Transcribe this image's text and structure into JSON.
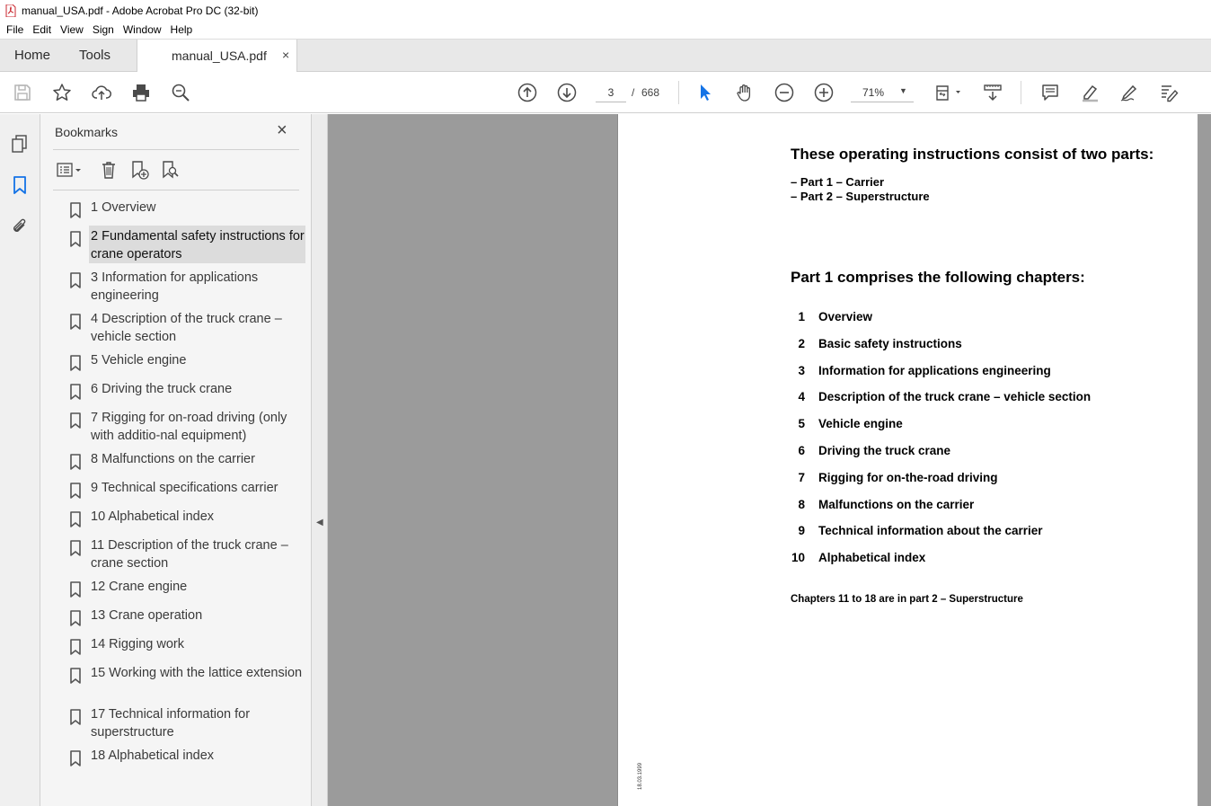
{
  "window": {
    "title": "manual_USA.pdf - Adobe Acrobat Pro DC (32-bit)"
  },
  "menu": [
    "File",
    "Edit",
    "View",
    "Sign",
    "Window",
    "Help"
  ],
  "tabs": {
    "home": "Home",
    "tools": "Tools",
    "document": "manual_USA.pdf",
    "close": "×"
  },
  "toolbar": {
    "page_current": "3",
    "page_separator": "/",
    "page_total": "668",
    "zoom": "71%"
  },
  "bookmarks_panel": {
    "title": "Bookmarks",
    "close": "×",
    "items": [
      {
        "label": "1 Overview",
        "selected": false
      },
      {
        "label": "2 Fundamental safety instructions for crane operators",
        "selected": true
      },
      {
        "label": "3 Information for applications engineering",
        "selected": false
      },
      {
        "label": "4 Description of the truck crane – vehicle section",
        "selected": false
      },
      {
        "label": "5 Vehicle engine",
        "selected": false
      },
      {
        "label": "6 Driving the truck crane",
        "selected": false
      },
      {
        "label": "7 Rigging for on-road driving (only with additio-nal equipment)",
        "selected": false
      },
      {
        "label": "8 Malfunctions on the carrier",
        "selected": false
      },
      {
        "label": "9 Technical specifications carrier",
        "selected": false
      },
      {
        "label": "10 Alphabetical index",
        "selected": false
      },
      {
        "label": "11 Description of the truck crane – crane section",
        "selected": false
      },
      {
        "label": "12 Crane engine",
        "selected": false
      },
      {
        "label": "13 Crane operation",
        "selected": false
      },
      {
        "label": "14 Rigging work",
        "selected": false
      },
      {
        "label": "15 Working with the lattice extension",
        "selected": false
      },
      {
        "label": "17 Technical information for superstructure",
        "selected": false
      },
      {
        "label": "18 Alphabetical index",
        "selected": false
      }
    ]
  },
  "document": {
    "heading1": "These operating instructions consist of two parts:",
    "part1": "– Part 1  –  Carrier",
    "part2": "– Part 2  –  Superstructure",
    "heading2": "Part 1 comprises the following chapters:",
    "chapters": [
      {
        "num": "1",
        "title": "Overview"
      },
      {
        "num": "2",
        "title": "Basic safety instructions"
      },
      {
        "num": "3",
        "title": "Information for applications engineering"
      },
      {
        "num": "4",
        "title": "Description of the truck crane – vehicle section"
      },
      {
        "num": "5",
        "title": "Vehicle engine"
      },
      {
        "num": "6",
        "title": "Driving the truck crane"
      },
      {
        "num": "7",
        "title": "Rigging for on-the-road driving"
      },
      {
        "num": "8",
        "title": "Malfunctions on the carrier"
      },
      {
        "num": "9",
        "title": "Technical information about the carrier"
      },
      {
        "num": "10",
        "title": "Alphabetical index"
      }
    ],
    "footnote": "Chapters 11 to 18 are in part 2  –  Superstructure",
    "side_code": "18.03.1999"
  },
  "colors": {
    "accent_blue": "#1473e6",
    "doc_background": "#9b9b9b",
    "panel_background": "#f5f5f5",
    "selected_bookmark": "#dcdcdc"
  }
}
